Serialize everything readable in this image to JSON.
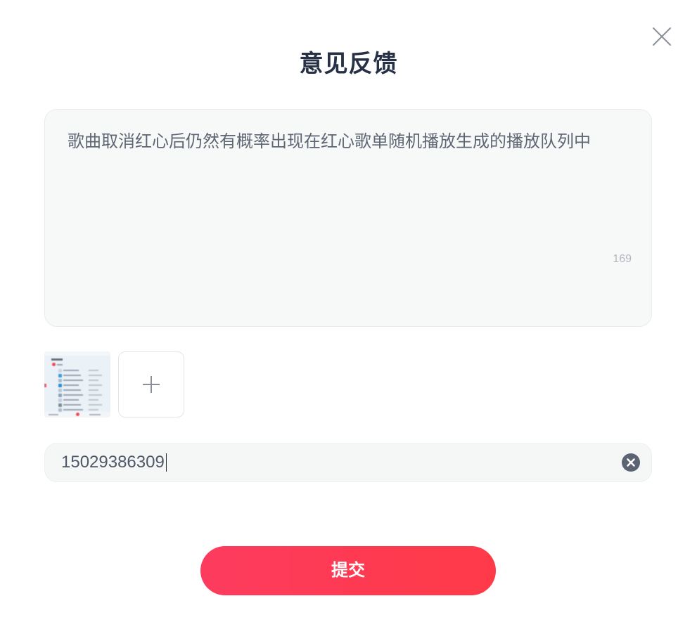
{
  "dialog": {
    "title": "意见反馈"
  },
  "feedback": {
    "text": "歌曲取消红心后仍然有概率出现在红心歌单随机播放生成的播放队列中",
    "char_count": "169"
  },
  "contact": {
    "phone": "15029386309"
  },
  "submit": {
    "label": "提交"
  },
  "icons": {
    "close": "close-icon",
    "add": "plus-icon",
    "clear": "clear-circle-icon"
  },
  "colors": {
    "title": "#273145",
    "accent_start": "#fd3b5e",
    "accent_end": "#ff3a48",
    "input_background": "#f5f7f7",
    "body_text": "#5f6673"
  }
}
